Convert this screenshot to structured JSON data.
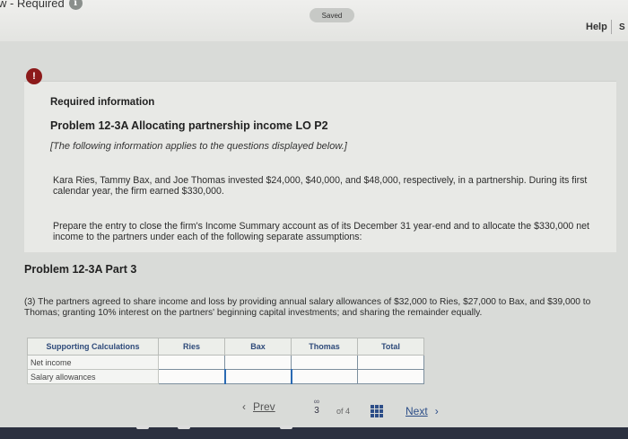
{
  "header": {
    "crumb": "w - Required",
    "saved": "Saved",
    "help": "Help",
    "help_s": "S"
  },
  "alert_icon": "!",
  "info": {
    "required_label": "Required information",
    "problem_title": "Problem 12-3A Allocating partnership income LO P2",
    "note": "[The following information applies to the questions displayed below.]",
    "para1": "Kara Ries, Tammy Bax, and Joe Thomas invested $24,000, $40,000, and $48,000, respectively, in a partnership. During its first calendar year, the firm earned $330,000.",
    "para2": "Prepare the entry to close the firm's Income Summary account as of its December 31 year-end and to allocate the $330,000 net income to the partners under each of the following separate assumptions:"
  },
  "part": {
    "title": "Problem 12-3A Part 3",
    "text": "(3) The partners agreed to share income and loss by providing annual salary allowances of $32,000 to Ries, $27,000 to Bax, and $39,000 to Thomas; granting 10% interest on the partners' beginning capital investments; and sharing the remainder equally."
  },
  "table": {
    "headers": [
      "Supporting Calculations",
      "Ries",
      "Bax",
      "Thomas",
      "Total"
    ],
    "rows": [
      {
        "label": "Net income"
      },
      {
        "label": "Salary allowances"
      }
    ]
  },
  "pager": {
    "prev": "Prev",
    "page": "3",
    "of": "of 4",
    "next": "Next"
  },
  "colors": {
    "alert": "#8c1a1a",
    "link": "#2d4e88",
    "input_focus": "#2a6ab3"
  }
}
